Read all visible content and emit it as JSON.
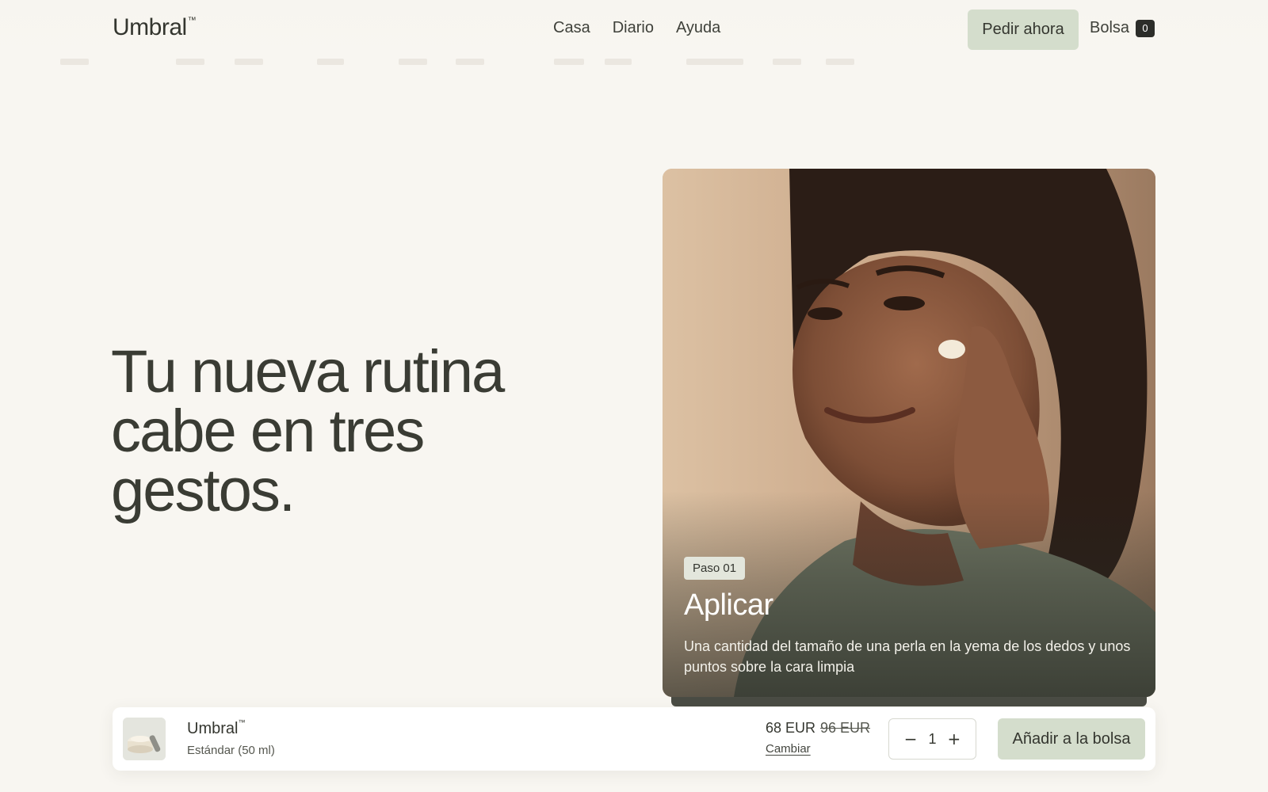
{
  "header": {
    "logo": "Umbral",
    "logo_mark": "™",
    "nav": [
      "Casa",
      "Diario",
      "Ayuda"
    ],
    "order_label": "Pedir ahora",
    "bag_label": "Bolsa",
    "bag_count": "0"
  },
  "hero": {
    "headline_lines": [
      "Tu nueva rutina",
      "cabe en tres",
      "gestos."
    ]
  },
  "step_card": {
    "badge": "Paso 01",
    "title": "Aplicar",
    "description": "Una cantidad del tamaño de una perla en la yema de los dedos y unos puntos sobre la cara limpia"
  },
  "buybar": {
    "product_name": "Umbral",
    "product_mark": "™",
    "variant": "Estándar (50 ml)",
    "price": "68 EUR",
    "old_price": "96 EUR",
    "change_label": "Cambiar",
    "qty_minus": "−",
    "qty_value": "1",
    "qty_plus": "+",
    "add_label": "Añadir a la bolsa"
  },
  "colors": {
    "background": "#f8f6f1",
    "accent": "#d4ddcc",
    "text": "#3a3c34"
  }
}
